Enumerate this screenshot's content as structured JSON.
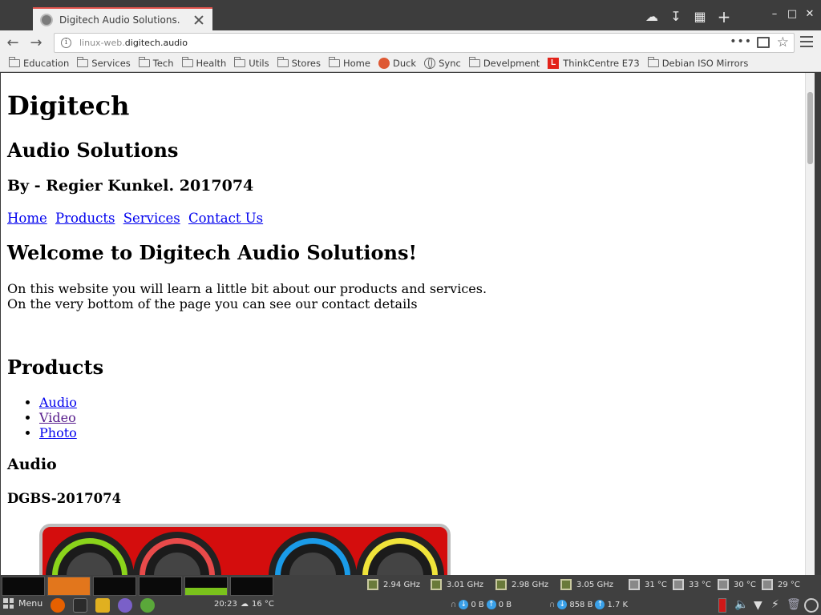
{
  "browser": {
    "tab_title": "Digitech Audio Solutions.",
    "url_host_prefix": "linux-web.",
    "url_host_domain": "digitech.audio"
  },
  "bookmarks": [
    {
      "label": "Education",
      "icon": "folder-icon"
    },
    {
      "label": "Services",
      "icon": "folder-icon"
    },
    {
      "label": "Tech",
      "icon": "folder-icon"
    },
    {
      "label": "Health",
      "icon": "folder-icon"
    },
    {
      "label": "Utils",
      "icon": "folder-icon"
    },
    {
      "label": "Stores",
      "icon": "folder-icon"
    },
    {
      "label": "Home",
      "icon": "folder-icon"
    },
    {
      "label": "Duck",
      "icon": "duckduckgo-icon"
    },
    {
      "label": "Sync",
      "icon": "globe-icon"
    },
    {
      "label": "Develpment",
      "icon": "folder-icon"
    },
    {
      "label": "ThinkCentre E73",
      "icon": "lenovo-icon",
      "icon_letter": "L"
    },
    {
      "label": "Debian ISO Mirrors",
      "icon": "folder-icon"
    }
  ],
  "page": {
    "title": "Digitech",
    "subtitle": "Audio Solutions",
    "byline": "By - Regier Kunkel. 2017074",
    "nav": [
      "Home",
      "Products",
      "Services",
      "Contact Us"
    ],
    "welcome_heading": "Welcome to Digitech Audio Solutions!",
    "intro_line1": "On this website you will learn a little bit about our products and services.",
    "intro_line2": "On the very bottom of the page you can see our contact details",
    "products_heading": "Products",
    "product_links": [
      "Audio",
      "Video",
      "Photo"
    ],
    "audio_heading": "Audio",
    "product_code": "DGBS-2017074",
    "product_knob_colors": [
      "#8bd41b",
      "#e84a4a",
      "#1a9be8",
      "#f0e43a"
    ]
  },
  "panel": {
    "menu_label": "Menu",
    "clock": "20:23",
    "weather": "16 °C",
    "cpu_freqs": [
      "2.94 GHz",
      "3.01 GHz",
      "2.98 GHz",
      "3.05 GHz"
    ],
    "temps": [
      "31 °C",
      "33 °C",
      "30 °C",
      "29 °C"
    ],
    "net1_down": "0 B",
    "net1_up": "0 B",
    "net2_down": "858 B",
    "net2_up": "1.7 K"
  }
}
